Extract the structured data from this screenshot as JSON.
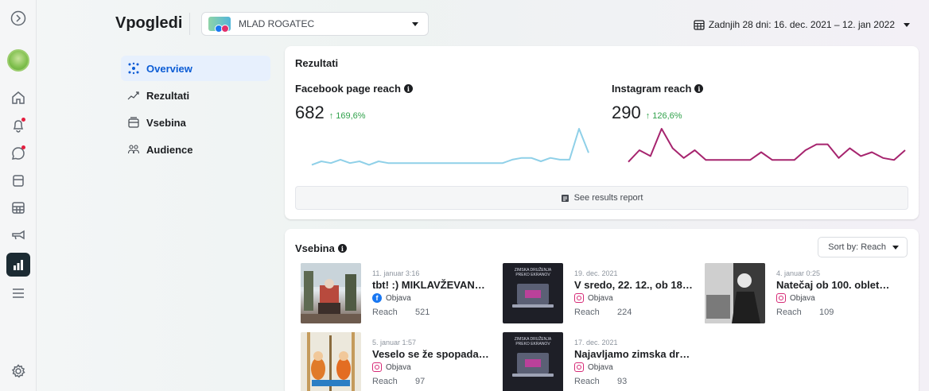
{
  "header": {
    "title": "Vpogledi",
    "account_name": "MLAD ROGATEC",
    "date_range": "Zadnjih 28 dni: 16. dec. 2021 – 12. jan 2022"
  },
  "rail": {
    "items": [
      "logo-icon",
      "avatar",
      "home-icon",
      "bell-icon",
      "chat-icon",
      "posts-icon",
      "planner-icon",
      "ads-icon",
      "insights-icon",
      "menu-icon",
      "settings-icon"
    ]
  },
  "subnav": {
    "items": [
      {
        "label": "Overview",
        "icon": "overview-icon",
        "active": true
      },
      {
        "label": "Rezultati",
        "icon": "trend-icon",
        "active": false
      },
      {
        "label": "Vsebina",
        "icon": "content-icon",
        "active": false
      },
      {
        "label": "Audience",
        "icon": "audience-icon",
        "active": false
      }
    ]
  },
  "results": {
    "title": "Rezultati",
    "facebook": {
      "label": "Facebook page reach",
      "value": "682",
      "change": "↑ 169,6%",
      "color": "#8fd0e8",
      "series": [
        4,
        6,
        5,
        7,
        5,
        6,
        4,
        6,
        5,
        5,
        5,
        5,
        5,
        5,
        5,
        5,
        5,
        5,
        5,
        5,
        5,
        7,
        8,
        8,
        6,
        8,
        7,
        7,
        25,
        11
      ]
    },
    "instagram": {
      "label": "Instagram reach",
      "value": "290",
      "change": "↑ 126,6%",
      "color": "#a6246e",
      "series": [
        5,
        11,
        8,
        22,
        12,
        7,
        11,
        6,
        6,
        6,
        6,
        6,
        10,
        6,
        6,
        6,
        11,
        14,
        14,
        7,
        12,
        8,
        10,
        7,
        6,
        11
      ]
    },
    "report_button": "See results report"
  },
  "content": {
    "title": "Vsebina",
    "sort_label": "Sort by: Reach",
    "reach_label": "Reach",
    "posts": [
      {
        "date": "11. januar 3:16",
        "title": "tbt! :) MIKLAVŽEVAN…",
        "type": "Objava",
        "platform": "facebook",
        "reach": "521",
        "thumb": "photo1"
      },
      {
        "date": "19. dec. 2021",
        "title": "V sredo, 22. 12., ob 18.…",
        "type": "Objava",
        "platform": "instagram",
        "reach": "224",
        "thumb": "laptop"
      },
      {
        "date": "4. januar 0:25",
        "title": "Natečaj ob 100. obletn…",
        "type": "Objava",
        "platform": "instagram",
        "reach": "109",
        "thumb": "bw"
      },
      {
        "date": "5. januar 1:57",
        "title": "Veselo se že spopadam…",
        "type": "Objava",
        "platform": "instagram",
        "reach": "97",
        "thumb": "craft"
      },
      {
        "date": "17. dec. 2021",
        "title": "Najavljamo zimska dru…",
        "type": "Objava",
        "platform": "instagram",
        "reach": "93",
        "thumb": "laptop"
      }
    ],
    "laptop_thumb_text": "ZIMSKA DRUŽENJA PREKO EKRANOV"
  }
}
